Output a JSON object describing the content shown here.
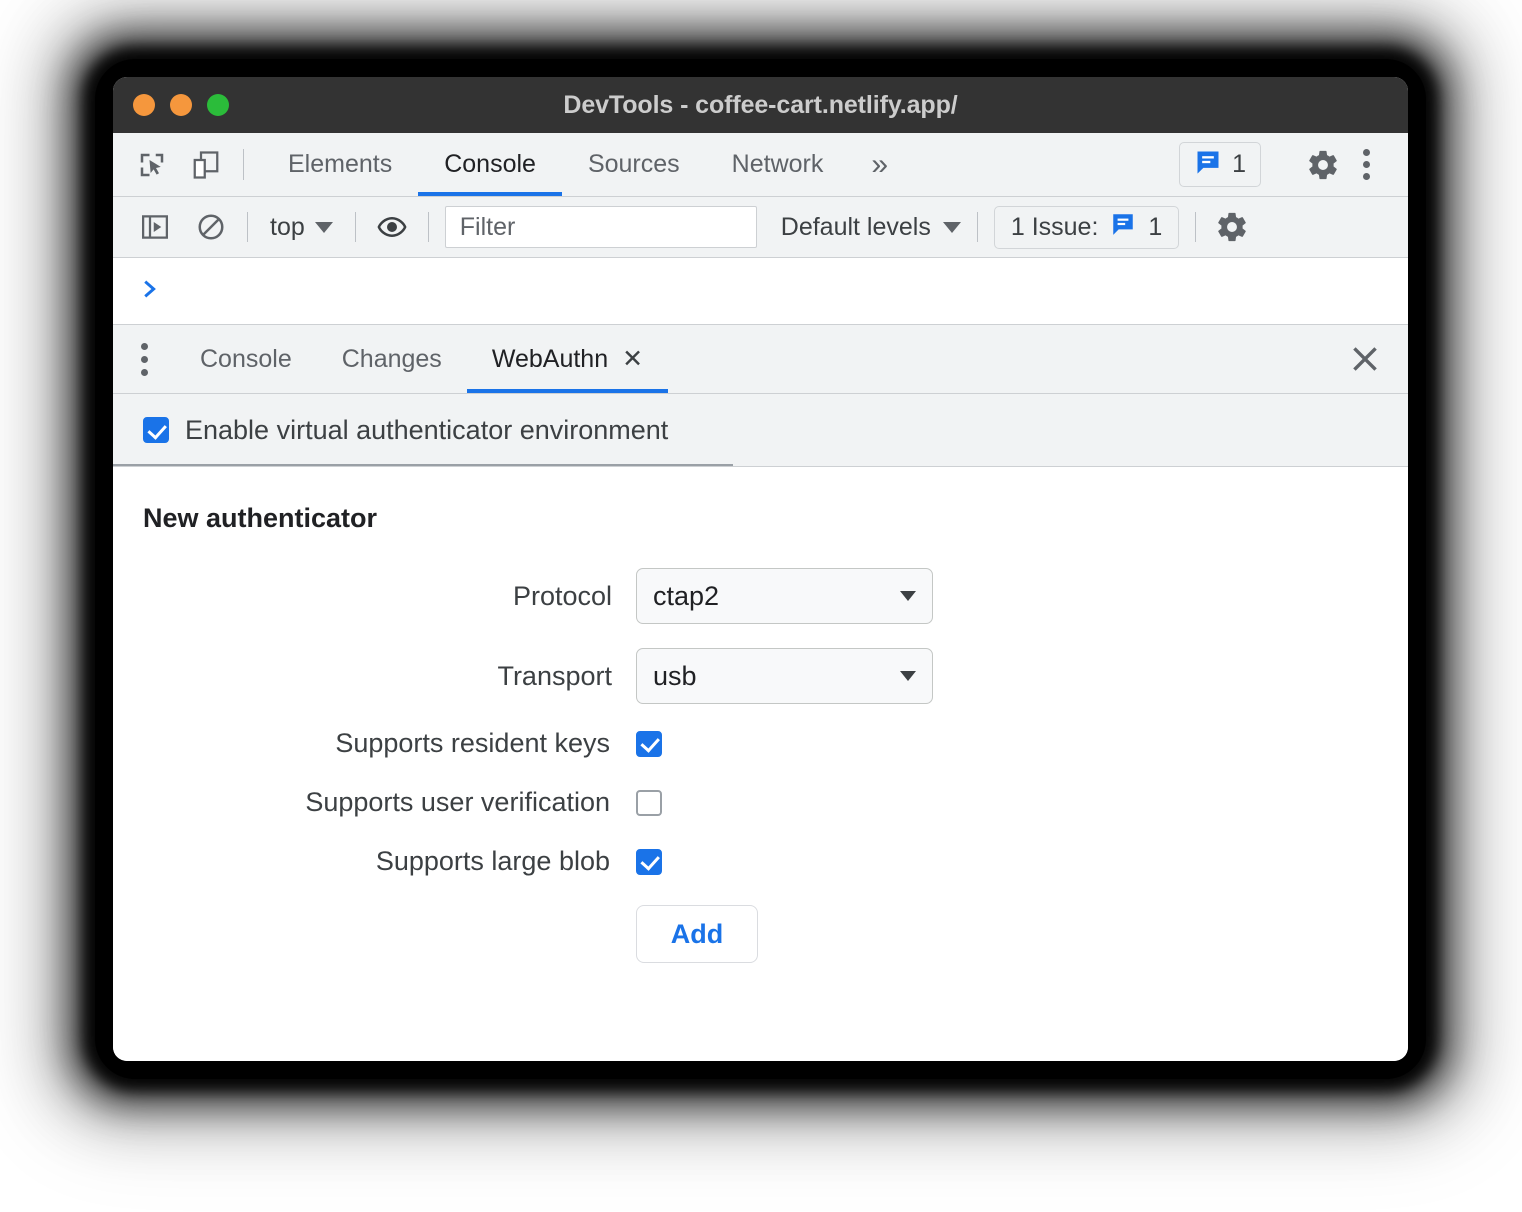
{
  "window": {
    "title": "DevTools - coffee-cart.netlify.app/",
    "traffic_lights": [
      "close",
      "minimize",
      "zoom"
    ],
    "colors": {
      "accent": "#1a73e8",
      "titlebar": "#333333",
      "toolbar": "#f1f3f4",
      "light_orange": "#f5973d",
      "light_green": "#2bbc3a"
    }
  },
  "panel_toolbar": {
    "inspect_icon": "inspect-element-icon",
    "device_icon": "device-toolbar-icon",
    "tabs": [
      {
        "label": "Elements",
        "active": false
      },
      {
        "label": "Console",
        "active": true
      },
      {
        "label": "Sources",
        "active": false
      },
      {
        "label": "Network",
        "active": false
      }
    ],
    "more_tabs_label": "»",
    "issues_badge_count": "1",
    "settings_icon": "gear-icon",
    "main_menu_icon": "kebab-menu-icon"
  },
  "console_toolbar": {
    "sidebar_icon": "show-console-sidebar-icon",
    "clear_icon": "clear-console-icon",
    "context": "top",
    "eye_icon": "live-expression-eye-icon",
    "filter_placeholder": "Filter",
    "filter_value": "",
    "levels": "Default levels",
    "issue_pill_label": "1 Issue:",
    "issue_pill_count": "1",
    "settings_icon": "console-settings-gear-icon"
  },
  "console": {
    "prompt_chevron": "›"
  },
  "drawer": {
    "more_icon": "drawer-kebab-menu-icon",
    "tabs": [
      {
        "label": "Console",
        "active": false,
        "closable": false
      },
      {
        "label": "Changes",
        "active": false,
        "closable": false
      },
      {
        "label": "WebAuthn",
        "active": true,
        "closable": true,
        "close_glyph": "✕"
      }
    ],
    "close_glyph": "✕"
  },
  "webauthn": {
    "enable": {
      "label": "Enable virtual authenticator environment",
      "checked": true
    },
    "heading": "New authenticator",
    "fields": [
      {
        "label": "Protocol",
        "value": "ctap2",
        "type": "select"
      },
      {
        "label": "Transport",
        "value": "usb",
        "type": "select"
      }
    ],
    "options": [
      {
        "label": "Supports resident keys",
        "checked": true
      },
      {
        "label": "Supports user verification",
        "checked": false
      },
      {
        "label": "Supports large blob",
        "checked": true
      }
    ],
    "add_button": "Add"
  }
}
